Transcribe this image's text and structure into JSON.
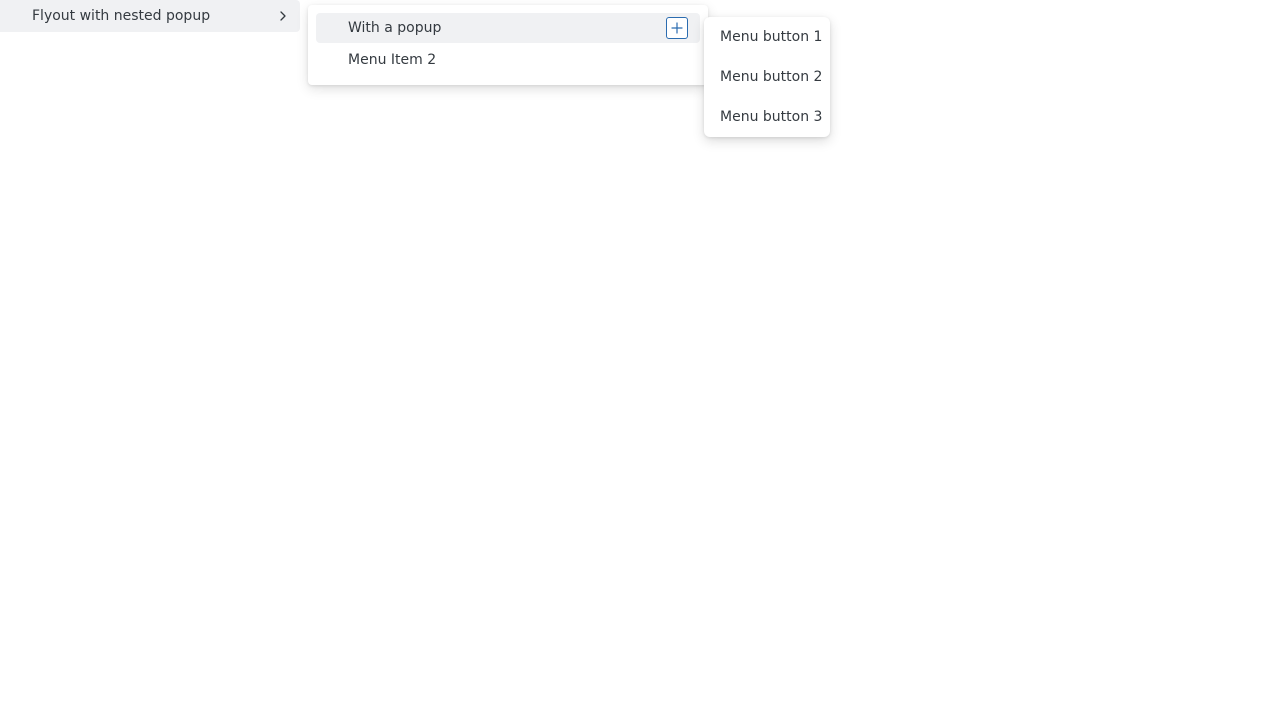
{
  "root_menu": {
    "item_label": "Flyout with nested popup",
    "chevron_icon": "chevron-right-icon"
  },
  "flyout": {
    "items": [
      {
        "label": "With a popup",
        "action_icon": "plus-icon"
      },
      {
        "label": "Menu Item 2"
      }
    ]
  },
  "popup": {
    "items": [
      {
        "label": "Menu button 1"
      },
      {
        "label": "Menu button 2"
      },
      {
        "label": "Menu button 3"
      }
    ]
  },
  "colors": {
    "accent": "#2b6cb0",
    "hover_background": "#f0f1f3",
    "text": "#343a40"
  }
}
